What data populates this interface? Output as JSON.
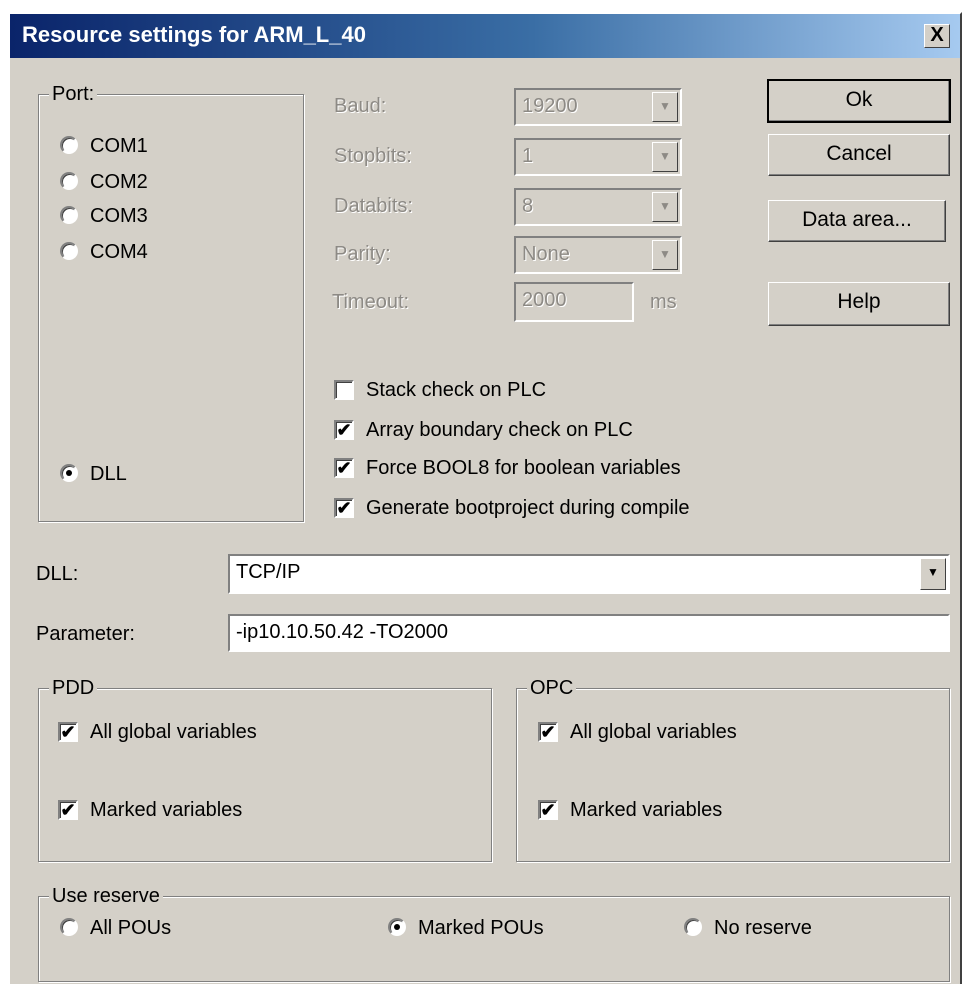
{
  "window": {
    "title": "Resource settings for ARM_L_40",
    "close_label": "X"
  },
  "port": {
    "group_label": "Port:",
    "options": [
      {
        "label": "COM1",
        "selected": false
      },
      {
        "label": "COM2",
        "selected": false
      },
      {
        "label": "COM3",
        "selected": false
      },
      {
        "label": "COM4",
        "selected": false
      },
      {
        "label": "DLL",
        "selected": true
      }
    ]
  },
  "serial": {
    "baud": {
      "label": "Baud:",
      "value": "19200"
    },
    "stopbits": {
      "label": "Stopbits:",
      "value": "1"
    },
    "databits": {
      "label": "Databits:",
      "value": "8"
    },
    "parity": {
      "label": "Parity:",
      "value": "None"
    },
    "timeout": {
      "label": "Timeout:",
      "value": "2000",
      "unit": "ms"
    }
  },
  "checks": [
    {
      "label": "Stack check on PLC",
      "checked": false
    },
    {
      "label": "Array boundary check on PLC",
      "checked": true
    },
    {
      "label": "Force BOOL8 for boolean variables",
      "checked": true
    },
    {
      "label": "Generate bootproject during compile",
      "checked": true
    }
  ],
  "buttons": {
    "ok": "Ok",
    "cancel": "Cancel",
    "data_area": "Data area...",
    "help": "Help"
  },
  "dll": {
    "label": "DLL:",
    "value": "TCP/IP"
  },
  "parameter": {
    "label": "Parameter:",
    "value": "-ip10.10.50.42 -TO2000"
  },
  "pdd": {
    "group_label": "PDD",
    "all_global": {
      "label": "All global variables",
      "checked": true
    },
    "marked": {
      "label": "Marked variables",
      "checked": true
    }
  },
  "opc": {
    "group_label": "OPC",
    "all_global": {
      "label": "All global variables",
      "checked": true
    },
    "marked": {
      "label": "Marked variables",
      "checked": true
    }
  },
  "reserve": {
    "group_label": "Use reserve",
    "options": [
      {
        "label": "All POUs",
        "selected": false
      },
      {
        "label": "Marked POUs",
        "selected": true
      },
      {
        "label": "No reserve",
        "selected": false
      }
    ]
  },
  "glyphs": {
    "check_mark": "✔",
    "dropdown_arrow": "▼"
  }
}
